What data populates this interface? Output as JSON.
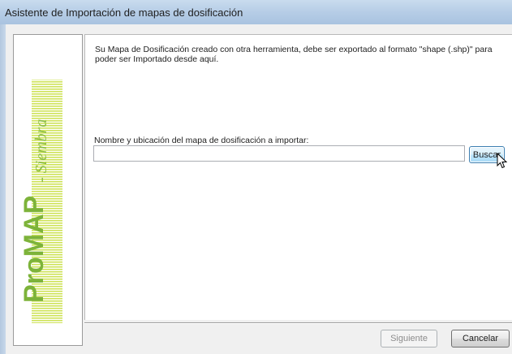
{
  "window": {
    "title": "Asistente de Importación de mapas de dosificación"
  },
  "logo": {
    "brand": "ProMAP - Siembra",
    "text_color": "#7db33a",
    "bar_color": "#cfe35a"
  },
  "content": {
    "description": "Su Mapa de Dosificación creado con otra herramienta, debe ser exportado al formato \"shape (.shp)\" para poder ser Importado desde aquí.",
    "file_label": "Nombre y ubicación del mapa de dosificación a importar:",
    "file_path_value": "",
    "browse_label": "Buscar"
  },
  "footer": {
    "next_label": "Siguiente",
    "cancel_label": "Cancelar"
  }
}
